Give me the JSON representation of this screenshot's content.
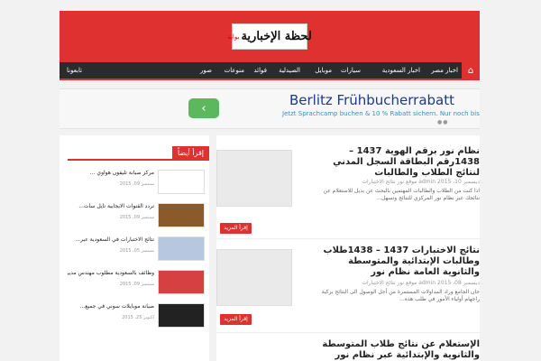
{
  "header": {
    "logo_main": "لحظة الإخبارية",
    "logo_prefix": "بوابة"
  },
  "nav": {
    "home_icon": "home-icon",
    "items": [
      "اخبار مصر",
      "اخبار السعودية",
      "سيارات",
      "موبايل",
      "الصيدلية",
      "فوائد",
      "منوعات",
      "صور",
      "تابعونا"
    ]
  },
  "ad": {
    "title": "Berlitz Frühbucherrabatt",
    "subtitle": "Jetzt Sprachcamp buchen & 10 % Rabatt sichern. Nur noch bis",
    "arrow": "‹",
    "dots": "●●"
  },
  "main": {
    "articles": [
      {
        "title": "نظام نور برقم الهوية 1437 – 1438رقم البطاقة السجل المدني لنتائج الطلاب والطالبات",
        "meta": "ديسمبر 10، 2015 admin موقع نور نتائج الاختبارات",
        "excerpt": "اذا كنت من الطلاب والطالبات المهتمين بالبحث عن بديل للاستعلام عن نتائجك عبر نظام نور المركزي للنتائج وتسهل...",
        "button": "إقرأ المزيد"
      },
      {
        "title": "نتائج الاختبارات 1437 – 1438طلاب وطالبات الإبتدائية والمتوسطة والثانوية العامة نظام نور",
        "meta": "ديسمبر 08، 2015 admin موقع نور نتائج الاختبارات",
        "excerpt": "حان الجامع وراد المداولات المستمرة من أجل الوصول الى النتائج بزكية راجهام أولياء الأمور في طلب هذه...",
        "button": "إقرأ المزيد"
      },
      {
        "title": "الإستعلام عن نتائج طلاب المتوسطة والثانوية والإبتدائية عبر نظام نور"
      }
    ]
  },
  "sidebar": {
    "heading": "إقرأ أيضاً",
    "items": [
      {
        "title": "مركز صيانة تليفون هواوي ...",
        "date": "سبتمبر 09، 2015"
      },
      {
        "title": "تردد القنوات الايجابية نايل سات...",
        "date": "سبتمبر 09، 2015"
      },
      {
        "title": "نتائج الاختبارات في السعودية عبر...",
        "date": "سبتمبر 05، 2015"
      },
      {
        "title": "وظائف بالسعودية مطلوب مهندس مدير...",
        "date": "سبتمبر 09، 2015"
      },
      {
        "title": "صيانة موبايلات سوني في جميع...",
        "date": "اكتوبر 25، 2015"
      }
    ]
  }
}
